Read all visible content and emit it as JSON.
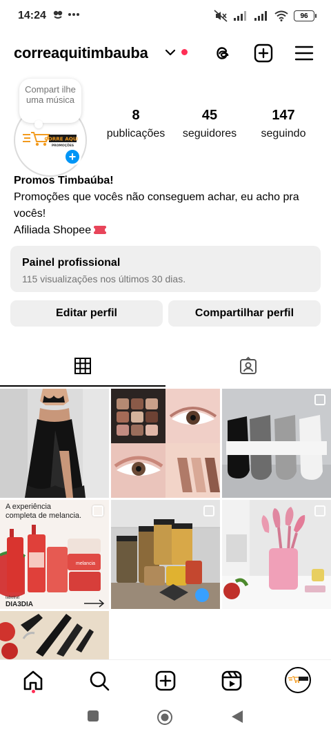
{
  "status_bar": {
    "time": "14:24",
    "battery": "96"
  },
  "header": {
    "username": "correaquitimbauba"
  },
  "profile": {
    "note": "Compart ilhe uma música",
    "logo_text": "CORRE AQUI!",
    "logo_subtext": "PROMOÇÕES",
    "stats": [
      {
        "value": "8",
        "label": "publicações"
      },
      {
        "value": "45",
        "label": "seguidores"
      },
      {
        "value": "147",
        "label": "seguindo"
      }
    ],
    "bio_name": "Promos Timbaúba!",
    "bio_text": "Promoções que vocês não conseguem achar, eu acho pra vocês!",
    "bio_affiliate": "Afiliada Shopee"
  },
  "pro_panel": {
    "title": "Painel profissional",
    "subtitle": "115 visualizações nos últimos 30 dias."
  },
  "buttons": {
    "edit": "Editar perfil",
    "share": "Compartilhar perfil"
  },
  "posts": [
    {
      "id": "post-black-skirt",
      "multi": false
    },
    {
      "id": "post-makeup",
      "multi": false
    },
    {
      "id": "post-socks",
      "multi": true
    },
    {
      "id": "post-melancia",
      "multi": true,
      "headline": "A experiência completa de melancia.",
      "brand": "DIA3DIA",
      "brand_small": "labotrat",
      "product": "melancia"
    },
    {
      "id": "post-containers",
      "multi": true
    },
    {
      "id": "post-kitchen-utensils",
      "multi": true
    },
    {
      "id": "post-knives",
      "multi": false
    }
  ],
  "colors": {
    "accent_blue": "#0095f6",
    "notification_red": "#ff2e55",
    "button_gray": "#efefef",
    "secondary_text": "#737373"
  },
  "icons": {
    "header": [
      "threads-icon",
      "new-post-icon",
      "menu-icon"
    ],
    "tabs": [
      "grid-icon",
      "tagged-icon"
    ],
    "bottom_nav": [
      "home-icon",
      "search-icon",
      "create-icon",
      "reels-icon",
      "profile-avatar"
    ]
  }
}
